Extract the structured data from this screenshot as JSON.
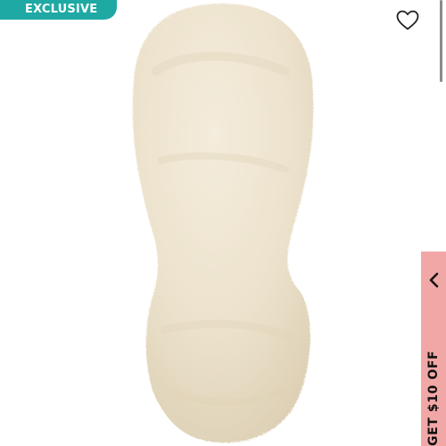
{
  "badge": {
    "label": "EXCLUSIVE",
    "color": "#1fa9a5"
  },
  "product_image": {
    "subject": "sheepskin insole",
    "color": "#ede2cd"
  },
  "wishlist": {
    "icon": "heart-outline-icon"
  },
  "promo_tab": {
    "label": "GET $10 OFF",
    "icon": "chevron-left-icon",
    "color": "#f2a7a7"
  }
}
